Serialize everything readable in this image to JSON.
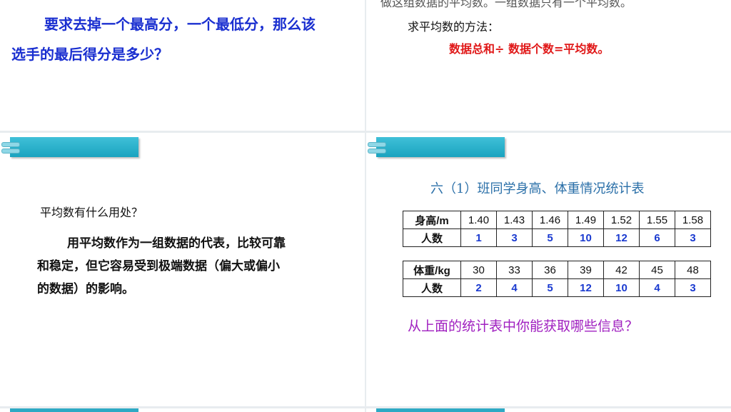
{
  "slide1": {
    "line1": "要求去掉一个最高分，一个最低分，那么该",
    "line2": "选手的最后得分是多少？"
  },
  "slide2": {
    "partial_top": "做这组数据的平均数。一组数据只有一个平均数。",
    "method_label": "求平均数的方法：",
    "formula": "数据总和÷ 数据个数=平均数。"
  },
  "slide3": {
    "question": "平均数有什么用处？",
    "answer_line1": "用平均数作为一组数据的代表，比较可靠",
    "answer_line2": "和稳定，但它容易受到极端数据（偏大或偏小",
    "answer_line3": "的数据）的影响。"
  },
  "slide4": {
    "table_title": "六（1）班同学身高、体重情况统计表",
    "height_table": {
      "header": "身高/m",
      "values": [
        "1.40",
        "1.43",
        "1.46",
        "1.49",
        "1.52",
        "1.55",
        "1.58"
      ],
      "count_label": "人数",
      "counts": [
        "1",
        "3",
        "5",
        "10",
        "12",
        "6",
        "3"
      ]
    },
    "weight_table": {
      "header": "体重/kg",
      "values": [
        "30",
        "33",
        "36",
        "39",
        "42",
        "45",
        "48"
      ],
      "count_label": "人数",
      "counts": [
        "2",
        "4",
        "5",
        "12",
        "10",
        "4",
        "3"
      ]
    },
    "prompt": "从上面的统计表中你能获取哪些信息？"
  },
  "colors": {
    "banner": "#1aa3bf",
    "emphasis_blue": "#1a2fd0",
    "formula_red": "#e01818",
    "prompt_purple": "#a020c0"
  }
}
